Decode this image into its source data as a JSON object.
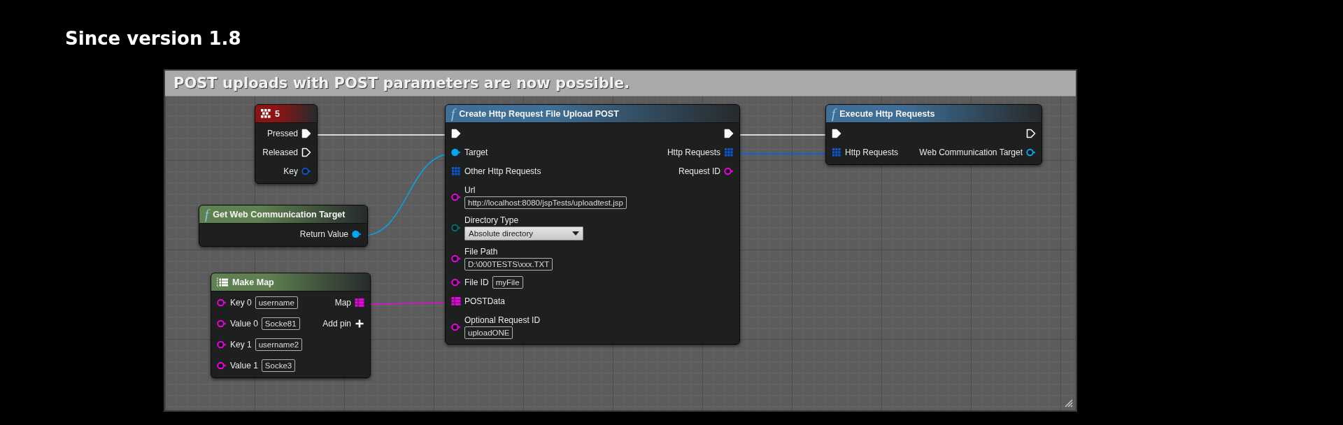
{
  "heading": "Since version 1.8",
  "comment": {
    "title": "POST uploads with POST parameters are now possible."
  },
  "nodes": [
    {
      "kind": "event",
      "title": "5",
      "color": "#8c1414",
      "rows": [
        {
          "right": {
            "kind": "exec",
            "label": "Pressed",
            "filled": true
          }
        },
        {
          "right": {
            "kind": "exec",
            "label": "Released",
            "filled": false
          }
        },
        {
          "right": {
            "kind": "struct",
            "label": "Key",
            "filled": false
          }
        }
      ]
    },
    {
      "kind": "function",
      "icon": "f",
      "title": "Get Web Communication Target",
      "color": "#5f8050",
      "rows": [
        {
          "right": {
            "kind": "object",
            "label": "Return Value",
            "filled": true
          }
        }
      ]
    },
    {
      "kind": "map",
      "title": "Make Map",
      "color": "#5f8050",
      "rows": [
        {
          "left": {
            "kind": "string",
            "label": "Key 0",
            "value": "username",
            "filled": false
          },
          "right": {
            "kind": "map",
            "label": "Map"
          }
        },
        {
          "left": {
            "kind": "string",
            "label": "Value 0",
            "value": "Socke81",
            "filled": false
          },
          "right": {
            "kind": "add",
            "label": "Add pin"
          }
        },
        {
          "left": {
            "kind": "string",
            "label": "Key 1",
            "value": "username2",
            "filled": false
          }
        },
        {
          "left": {
            "kind": "string",
            "label": "Value 1",
            "value": "Socke3",
            "filled": false
          }
        }
      ]
    },
    {
      "kind": "function",
      "icon": "f",
      "title": "Create Http Request File Upload POST",
      "color": "#3f6f96",
      "rows": [
        {
          "left": {
            "kind": "exec",
            "filled": true
          },
          "right": {
            "kind": "exec",
            "filled": true
          }
        },
        {
          "left": {
            "kind": "object",
            "label": "Target",
            "filled": true
          },
          "right": {
            "kind": "array",
            "label": "Http Requests"
          }
        },
        {
          "left": {
            "kind": "array",
            "label": "Other Http Requests"
          },
          "right": {
            "kind": "string",
            "label": "Request ID",
            "filled": false
          }
        },
        {
          "left": {
            "kind": "string",
            "label": "Url",
            "value": "http://localhost:8080/jspTests/uploadtest.jsp",
            "stacked": true,
            "filled": false
          }
        },
        {
          "left": {
            "kind": "enum",
            "label": "Directory Type",
            "value": "Absolute directory",
            "stacked": true,
            "filled": false
          }
        },
        {
          "left": {
            "kind": "string",
            "label": "File Path",
            "value": "D:\\000TESTS\\xxx.TXT",
            "stacked": true,
            "filled": false
          }
        },
        {
          "left": {
            "kind": "string",
            "label": "File ID",
            "value": "myFile",
            "filled": false
          }
        },
        {
          "left": {
            "kind": "map",
            "label": "POSTData"
          }
        },
        {
          "left": {
            "kind": "string",
            "label": "Optional Request ID",
            "value": "uploadONE",
            "stacked": true,
            "filled": false
          }
        }
      ]
    },
    {
      "kind": "function",
      "icon": "f",
      "title": "Execute Http Requests",
      "color": "#3f6f96",
      "rows": [
        {
          "left": {
            "kind": "exec",
            "filled": true
          },
          "right": {
            "kind": "exec",
            "filled": false
          }
        },
        {
          "left": {
            "kind": "array",
            "label": "Http Requests"
          },
          "right": {
            "kind": "object",
            "label": "Web Communication Target",
            "filled": false
          }
        }
      ]
    }
  ]
}
